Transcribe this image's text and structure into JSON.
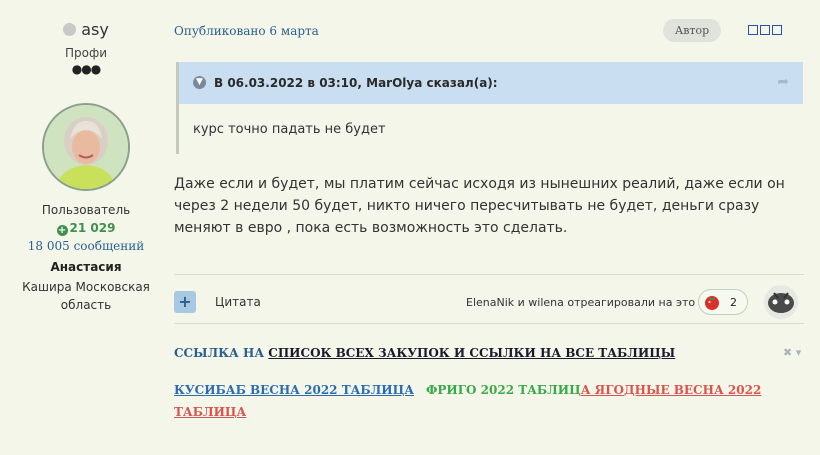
{
  "user": {
    "name": "asy",
    "rank": "Профи",
    "rank_dots": "●●●",
    "role": "Пользователь",
    "points": "21 029",
    "messages": "18 005 сообщений",
    "real_name": "Анастасия",
    "location": "Кашира Московская область"
  },
  "post": {
    "published": "Опубликовано 6 марта",
    "author_badge": "Автор",
    "quote": {
      "header": "В 06.03.2022 в 03:10, MarOlya сказал(а):",
      "text": "курс точно падать не будет"
    },
    "text": "Даже если и будет, мы платим сейчас исходя из нынешних реалий, даже если он через 2 недели 50 будет, никто ничего пересчитывать не будет, деньги сразу меняют в евро , пока есть возможность это сделать."
  },
  "actions": {
    "plus": "+",
    "quote_label": "Цитата",
    "reactions_text": "ElenaNik и wilena отреагировали на это",
    "reaction_count": "2"
  },
  "signature": {
    "line1_prefix": "ССЫЛКА НА ",
    "line1_link": "СПИСОК ВСЕХ ЗАКУПОК И ССЫЛКИ НА ВСЕ ТАБЛИЦЫ",
    "close": "✖ ▾",
    "link_blue": "КУСИБАБ ВЕСНА 2022 ТАБЛИЦА",
    "link_green_a": "ФРИГО 2022 ТАБЛИЦ",
    "link_green_b": "А ЯГО",
    "link_red": "ДНЫЕ ВЕСНА 2022 ТАБЛИЦА"
  },
  "colors": {
    "background": "#f3f6e8",
    "accent_blue": "#2b5f8e",
    "quote_header": "#c9dff1",
    "points_green": "#3f8f52",
    "sig_green": "#3aa84a",
    "sig_red": "#d9534f"
  }
}
